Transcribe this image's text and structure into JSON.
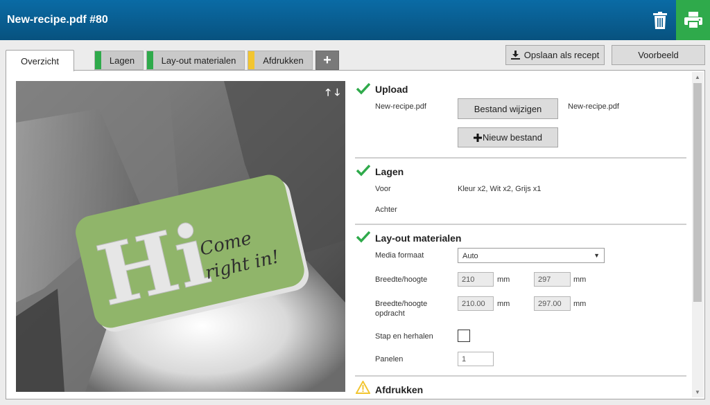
{
  "header": {
    "title": "New-recipe.pdf #80"
  },
  "tabs": {
    "overzicht": "Overzicht",
    "lagen": "Lagen",
    "layout": "Lay-out materialen",
    "afdrukken": "Afdrukken",
    "add": "+"
  },
  "tab_colors": {
    "lagen": "#2faa4b",
    "layout": "#2faa4b",
    "afdrukken": "#f2c530"
  },
  "toolbar": {
    "save_label": "Opslaan als recept",
    "preview_label": "Voorbeeld"
  },
  "preview": {
    "arrows": "🡑🡓",
    "art": {
      "big_text": "Hi",
      "script_line1": "Come",
      "script_line2": "right in!"
    }
  },
  "upload": {
    "title": "Upload",
    "filename": "New-recipe.pdf",
    "change_button": "Bestand wijzigen",
    "current_file": "New-recipe.pdf",
    "new_button": "Nieuw bestand"
  },
  "lagen": {
    "title": "Lagen",
    "voor_label": "Voor",
    "voor_value": "Kleur x2, Wit x2, Grijs x1",
    "achter_label": "Achter"
  },
  "layout": {
    "title": "Lay-out materialen",
    "media_label": "Media formaat",
    "media_value": "Auto",
    "size_label": "Breedte/hoogte",
    "width": "210",
    "height": "297",
    "unit": "mm",
    "job_size_label_1": "Breedte/hoogte",
    "job_size_label_2": "opdracht",
    "job_width": "210.00",
    "job_height": "297.00",
    "step_repeat_label": "Stap en herhalen",
    "panels_label": "Panelen",
    "panels_value": "1"
  },
  "afdrukken": {
    "title": "Afdrukken"
  },
  "colors": {
    "header": "#0a6ba5",
    "accent_green": "#2faa4b",
    "warning": "#f2c530"
  }
}
